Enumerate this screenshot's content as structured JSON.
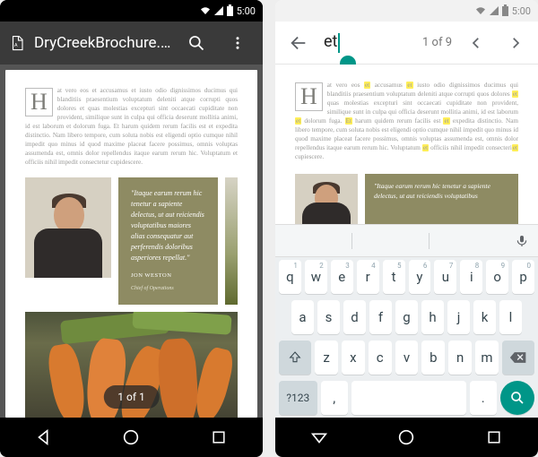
{
  "status": {
    "time": "5:00"
  },
  "left": {
    "appbar": {
      "title": "DryCreekBrochure.pdf"
    },
    "document": {
      "paragraph": "at vero eos et accusamus et iusto odio dignissimos ducimus qui blanditiis praesentium voluptatum deleniti atque corrupti quos dolores et quas molestias excepturi sint occaecati cupiditate non provident, similique sunt in culpa qui officia deserunt mollitia animi, id est laborum et dolorum fuga. Et harum quidem rerum facilis est et expedita distinctio. Nam libero tempore, cum soluta nobis est eligendi optio cumque nihil impedit quo minus id quod maxime placeat facere possimus, omnis voluptas assumenda est, omnis dolor repellendus itaque earum rerum hic. Voluptatum et officiis nihil impedit consectetur cupidescere.",
      "dropcap": "H",
      "quote": {
        "text": "\"Itaque earum rerum hic tenetur a sapiente delectus, ut aut reiciendis voluptatibus maiores alias consequatur aut perferendis doloribus asperiores repellat.\"",
        "name": "JON WESTON",
        "role": "Chief of Operations"
      }
    },
    "page_badge": "1 of 1"
  },
  "right": {
    "search": {
      "query": "et",
      "result_counter": "1 of 9"
    },
    "document": {
      "dropcap": "H",
      "tokens": [
        {
          "t": "at vero eos "
        },
        {
          "t": "et",
          "h": true
        },
        {
          "t": " accusamus "
        },
        {
          "t": "et",
          "h": true
        },
        {
          "t": " iusto odio dignissimos ducimus qui blanditiis praesentium voluptatum deleniti atque corrupti quos dolores "
        },
        {
          "t": "et",
          "h": true
        },
        {
          "t": " quas molestias excepturi sint occaecati cupiditate non provident, similique sunt in culpa qui officia deserunt mollitia animi, id est laborum "
        },
        {
          "t": "et",
          "h": true
        },
        {
          "t": " dolorum fuga. "
        },
        {
          "t": "Et",
          "h": true
        },
        {
          "t": " harum quidem rerum facilis est "
        },
        {
          "t": "et",
          "h": true
        },
        {
          "t": " expedita distinctio. Nam libero tempore, cum soluta nobis est eligendi optio cumque nihil impedit quo minus id quod maxime placeat facere possimus, omnis voluptas assumenda est, omnis dolor repellendus itaque earum rerum hic. Voluptatum "
        },
        {
          "t": "et",
          "h": true
        },
        {
          "t": " officiis nihil impedit consecteri"
        },
        {
          "t": "et",
          "h": true
        },
        {
          "t": " cupiescere."
        }
      ],
      "quote": {
        "text": "\"Itaque earum rerum hic tenetur a sapiente delectus, ut aut reiciendis voluptatibus",
        "name": "",
        "role": ""
      }
    },
    "keyboard": {
      "row1": [
        {
          "k": "q",
          "n": "1"
        },
        {
          "k": "w",
          "n": "2"
        },
        {
          "k": "e",
          "n": "3"
        },
        {
          "k": "r",
          "n": "4"
        },
        {
          "k": "t",
          "n": "5"
        },
        {
          "k": "y",
          "n": "6"
        },
        {
          "k": "u",
          "n": "7"
        },
        {
          "k": "i",
          "n": "8"
        },
        {
          "k": "o",
          "n": "9"
        },
        {
          "k": "p",
          "n": "0"
        }
      ],
      "row2": [
        {
          "k": "a"
        },
        {
          "k": "s"
        },
        {
          "k": "d"
        },
        {
          "k": "f"
        },
        {
          "k": "g"
        },
        {
          "k": "h"
        },
        {
          "k": "j"
        },
        {
          "k": "k"
        },
        {
          "k": "l"
        }
      ],
      "row3": [
        {
          "k": "z"
        },
        {
          "k": "x"
        },
        {
          "k": "c"
        },
        {
          "k": "v"
        },
        {
          "k": "b"
        },
        {
          "k": "n"
        },
        {
          "k": "m"
        }
      ],
      "sym_key": "?123",
      "comma_key": ",",
      "period_key": "."
    }
  }
}
